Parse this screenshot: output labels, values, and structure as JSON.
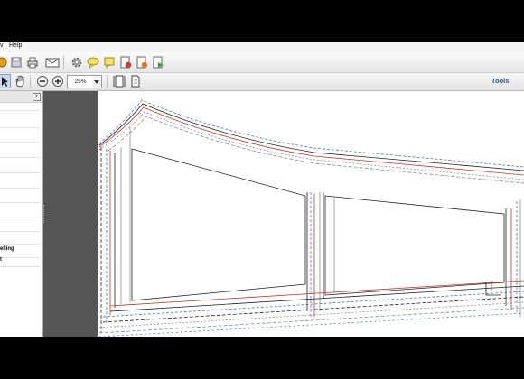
{
  "menu": {
    "partial_item": "v",
    "help": "Help"
  },
  "toolbar": {
    "zoom_value": "25%",
    "tools_label": "Tools",
    "icons": [
      "create-icon",
      "save-icon",
      "print-icon",
      "email-icon",
      "settings-icon",
      "comment-icon",
      "sticky-note-icon",
      "sign-icon",
      "stamp-icon",
      "share-icon"
    ],
    "nav_icons": [
      "select-arrow-icon",
      "hand-icon",
      "zoom-out-icon",
      "zoom-in-icon",
      "fit-width-icon",
      "fit-page-icon"
    ]
  },
  "left_panel": {
    "close_glyph": "x",
    "items": [
      "elling",
      "t"
    ]
  },
  "document": {
    "content": "technical drawing outline of a long building profile with a stepped roof line",
    "line_colors": {
      "red": "#c0392b",
      "blue": "#4a6fd1",
      "black": "#222222",
      "gray": "#8e8e8e"
    }
  }
}
